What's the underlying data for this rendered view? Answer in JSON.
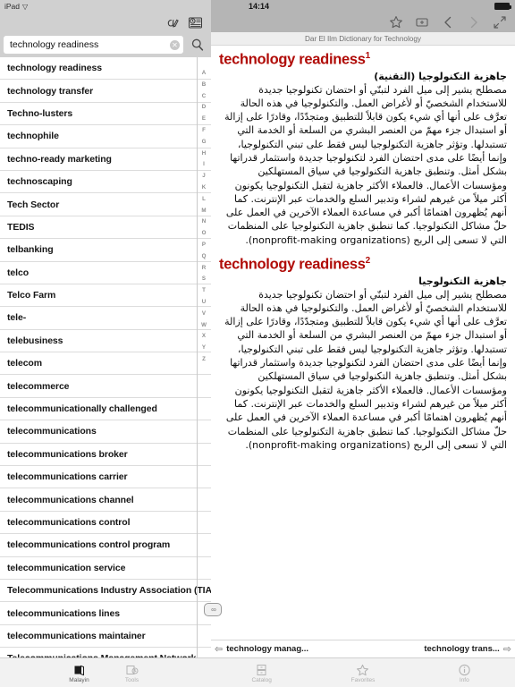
{
  "statusbar": {
    "device": "iPad",
    "wifi_icon": "wifi-icon",
    "time": "14:14",
    "battery_icon": "battery-full-icon"
  },
  "left": {
    "toolbar": [
      {
        "name": "script-toggle-icon",
        "label": "script-toggle"
      },
      {
        "name": "history-icon",
        "label": "history"
      }
    ],
    "search": {
      "value": "technology readiness",
      "placeholder": "Search",
      "clear_label": "✕",
      "search_icon": "search-icon"
    },
    "alpha_index": [
      "A",
      "B",
      "C",
      "D",
      "E",
      "F",
      "G",
      "H",
      "I",
      "J",
      "K",
      "L",
      "M",
      "N",
      "O",
      "P",
      "Q",
      "R",
      "S",
      "T",
      "U",
      "V",
      "W",
      "X",
      "Y",
      "Z"
    ],
    "results": [
      "technology readiness",
      "technology transfer",
      "Techno-lusters",
      "technophile",
      "techno-ready marketing",
      "technoscaping",
      "Tech Sector",
      "TEDIS",
      "telbanking",
      "telco",
      "Telco Farm",
      "tele-",
      "telebusiness",
      "telecom",
      "telecommerce",
      "telecommunicationally challenged",
      "telecommunications",
      "telecommunications broker",
      "telecommunications carrier",
      "telecommunications channel",
      "telecommunications control",
      "telecommunications control program",
      "telecommunication service",
      "Telecommunications Industry Association (TIA)",
      "telecommunications lines",
      "telecommunications maintainer",
      "Telecommunications Management Network"
    ],
    "tabs": [
      {
        "label": "Malayin",
        "icon": "book-icon",
        "active": true
      },
      {
        "label": "Tools",
        "icon": "tools-icon",
        "active": false
      }
    ]
  },
  "divider": {
    "handle_icon": "pane-resize-handle",
    "dots": "∞"
  },
  "right": {
    "toolbar": [
      {
        "name": "favorite-star-icon",
        "glyph": "☆"
      },
      {
        "name": "add-to-list-icon",
        "glyph": "+"
      },
      {
        "name": "back-chevron-icon",
        "glyph": "‹"
      },
      {
        "name": "forward-chevron-icon",
        "glyph": "›"
      },
      {
        "name": "expand-fullscreen-icon",
        "glyph": "⤡"
      }
    ],
    "dictionary_title": "Dar El Ilm Dictionary for Technology",
    "entries": [
      {
        "headword": "technology readiness",
        "sense": "1",
        "arabic_head": "جاهزية التكنولوجيا (التقنية)",
        "arabic_body": "مصطلح يشير إلى ميل الفرد لتبنّي أو احتضان تكنولوجيا جديدة للاستخدام الشخصيّ أو لأغراض العمل. والتكنولوجيا في هذه الحالة تعرَّف على أنها أي شيء يكون قابلاً للتطبيق ومتجدّدًا، وقادرًا على إزالة أو استبدال جزء مهمّ من العنصر البشري من السلعة أو الخدمة التي تستبدلها. وتؤثر جاهزية التكنولوجيا ليس فقط على تبني التكنولوجيا، وإنما أيضًا على مدى احتضان الفرد لتكنولوجيا جديدة واستثمار قدراتها بشكل أمثل. وتنطبق جاهزية التكنولوجيا في سياق المستهلكين ومؤسسات الأعمال. فالعملاء الأكثر جاهزية لتقبل التكنولوجيا يكونون أكثر ميلاً من غيرهم لشراء وتدبير السلع والخدمات عبر الإنترنت. كما أنهم يُظهرون اهتمامًا أكبر في مساعدة العملاء الآخرين في العمل على حلّ مشاكل التكنولوجيا. كما تنطبق جاهزية التكنولوجيا على المنظمات التي لا تسعى إلى الربح (nonprofit-making organizations)."
      },
      {
        "headword": "technology readiness",
        "sense": "2",
        "arabic_head": "جاهزية التكنولوجيا",
        "arabic_body": "مصطلح يشير إلى ميل الفرد لتبنّي أو احتضان تكنولوجيا جديدة للاستخدام الشخصيّ أو لأغراض العمل. والتكنولوجيا في هذه الحالة تعرَّف على أنها أي شيء يكون قابلاً للتطبيق ومتجدّدًا، وقادرًا على إزالة أو استبدال جزء مهمّ من العنصر البشري من السلعة أو الخدمة التي تستبدلها. وتؤثر جاهزية التكنولوجيا ليس فقط على تبني التكنولوجيا، وإنما أيضًا على مدى احتضان الفرد لتكنولوجيا جديدة واستثمار قدراتها بشكل أمثل. وتنطبق جاهزية التكنولوجيا في سياق المستهلكين ومؤسسات الأعمال. فالعملاء الأكثر جاهزية لتقبل التكنولوجيا يكونون أكثر ميلاً من غيرهم لشراء وتدبير السلع والخدمات عبر الإنترنت. كما أنهم يُظهرون اهتمامًا أكبر في مساعدة العملاء الآخرين في العمل على حلّ مشاكل التكنولوجيا. كما تنطبق جاهزية التكنولوجيا على المنظمات التي لا تسعى إلى الربح (nonprofit-making organizations)."
      }
    ],
    "nav": {
      "prev_label": "technology manag...",
      "next_label": "technology trans...",
      "prev_icon": "prev-entry-arrow-icon",
      "next_icon": "next-entry-arrow-icon"
    },
    "tabs": [
      {
        "label": "Catalog",
        "icon": "catalog-icon",
        "active": false
      },
      {
        "label": "Favorites",
        "icon": "star-icon",
        "active": false
      },
      {
        "label": "Info",
        "icon": "info-icon",
        "active": false
      }
    ]
  },
  "colors": {
    "headword": "#B00B07",
    "toolbar_left": "#D0D0D0",
    "toolbar_right": "#B5B5B5",
    "dictbar": "#EEEEEE"
  }
}
